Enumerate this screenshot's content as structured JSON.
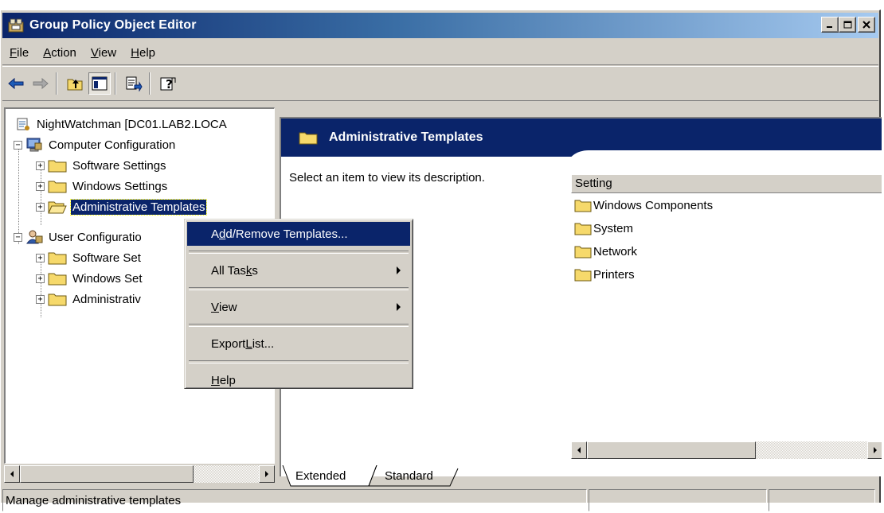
{
  "window": {
    "title": "Group Policy Object Editor",
    "minimize_label": "_",
    "maximize_label": "□",
    "close_label": "×"
  },
  "menubar": {
    "items": [
      {
        "key": "F",
        "rest": "ile"
      },
      {
        "key": "A",
        "rest": "ction"
      },
      {
        "key": "V",
        "rest": "iew"
      },
      {
        "key": "H",
        "rest": "elp"
      }
    ]
  },
  "toolbar": {
    "icons": [
      "back-arrow-icon",
      "forward-arrow-icon",
      "up-folder-icon",
      "show-hide-tree-icon",
      "export-list-icon",
      "help-icon"
    ]
  },
  "tree": {
    "root": "NightWatchman [DC01.LAB2.LOCA",
    "computer_config": "Computer Configuration",
    "cc_software": "Software Settings",
    "cc_windows": "Windows Settings",
    "cc_admin": "Administrative Templates",
    "user_config": "User Configuratio",
    "uc_software": "Software Set",
    "uc_windows": "Windows Set",
    "uc_admin": "Administrativ"
  },
  "right_pane": {
    "header_title": "Administrative Templates",
    "description": "Select an item to view its description.",
    "column_header": "Setting",
    "items": [
      "Windows Components",
      "System",
      "Network",
      "Printers"
    ]
  },
  "tabs": {
    "extended": "Extended",
    "standard": "Standard"
  },
  "context_menu": {
    "add_remove_pre": "A",
    "add_remove_key": "d",
    "add_remove_post": "d/Remove Templates...",
    "all_tasks_pre": "All Tas",
    "all_tasks_key": "k",
    "all_tasks_post": "s",
    "view_key": "V",
    "view_post": "iew",
    "export_pre": "Export ",
    "export_key": "L",
    "export_post": "ist...",
    "help_key": "H",
    "help_post": "elp"
  },
  "statusbar": {
    "text": "Manage administrative templates"
  },
  "colors": {
    "title_active": "#0a246a",
    "face": "#d4d0c8",
    "selection": "#0a246a",
    "folder": "#f6d96b"
  }
}
